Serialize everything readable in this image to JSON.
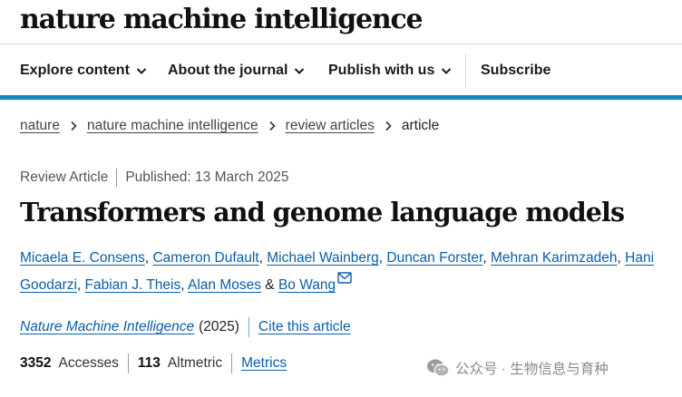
{
  "header": {
    "brand": "nature machine intelligence",
    "nav": [
      {
        "label": "Explore content",
        "has_dropdown": true
      },
      {
        "label": "About the journal",
        "has_dropdown": true
      },
      {
        "label": "Publish with us",
        "has_dropdown": true
      },
      {
        "label": "Subscribe",
        "has_dropdown": false
      }
    ],
    "accent_color": "#0e8ab8"
  },
  "breadcrumb": {
    "items": [
      "nature",
      "nature machine intelligence",
      "review articles"
    ],
    "current": "article"
  },
  "article": {
    "type": "Review Article",
    "published": "Published: 13 March 2025",
    "title": "Transformers and genome language models",
    "authors": [
      "Micaela E. Consens",
      "Cameron Dufault",
      "Michael Wainberg",
      "Duncan Forster",
      "Mehran Karimzadeh",
      "Hani Goodarzi",
      "Fabian J. Theis",
      "Alan Moses",
      "Bo Wang"
    ],
    "author_and": "&",
    "journal": "Nature Machine Intelligence",
    "year": "(2025)",
    "cite_label": "Cite this article"
  },
  "metrics": {
    "accesses_count": "3352",
    "accesses_label": "Accesses",
    "altmetric_count": "113",
    "altmetric_label": "Altmetric",
    "metrics_link": "Metrics"
  },
  "watermark": {
    "text": "公众号 · 生物信息与育种",
    "icon": "wechat-icon"
  }
}
